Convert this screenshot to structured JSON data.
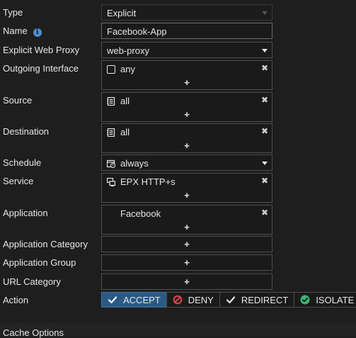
{
  "form": {
    "type": {
      "label": "Type",
      "value": "Explicit"
    },
    "name": {
      "label": "Name",
      "value": "Facebook-App",
      "info_icon": "info-icon"
    },
    "explicit_proxy": {
      "label": "Explicit Web Proxy",
      "value": "web-proxy"
    },
    "outgoing_interface": {
      "label": "Outgoing Interface",
      "entry": "any",
      "icon": "interface-checkbox-icon"
    },
    "source": {
      "label": "Source",
      "entry": "all",
      "icon": "address-book-icon"
    },
    "destination": {
      "label": "Destination",
      "entry": "all",
      "icon": "address-book-icon"
    },
    "schedule": {
      "label": "Schedule",
      "value": "always",
      "icon": "calendar-clock-icon"
    },
    "service": {
      "label": "Service",
      "entry": "EPX HTTP+s",
      "icon": "service-monitor-icon"
    },
    "application": {
      "label": "Application",
      "entry": "Facebook",
      "icon": "facebook-icon"
    },
    "application_category": {
      "label": "Application Category"
    },
    "application_group": {
      "label": "Application Group"
    },
    "url_category": {
      "label": "URL Category"
    },
    "action": {
      "label": "Action",
      "options": [
        {
          "label": "ACCEPT",
          "icon": "check-icon",
          "selected": true
        },
        {
          "label": "DENY",
          "icon": "deny-icon",
          "selected": false
        },
        {
          "label": "REDIRECT",
          "icon": "check-icon",
          "selected": false
        },
        {
          "label": "ISOLATE",
          "icon": "check-circle-icon",
          "selected": false
        }
      ]
    }
  },
  "section": {
    "cache_options": "Cache Options"
  },
  "glyphs": {
    "plus": "+",
    "close": "✖"
  },
  "colors": {
    "background": "#1e1e1e",
    "accept_active": "#2a5a84",
    "deny_red": "#e0484a",
    "isolate_green": "#3cb371",
    "info_blue": "#4a8fd8"
  }
}
